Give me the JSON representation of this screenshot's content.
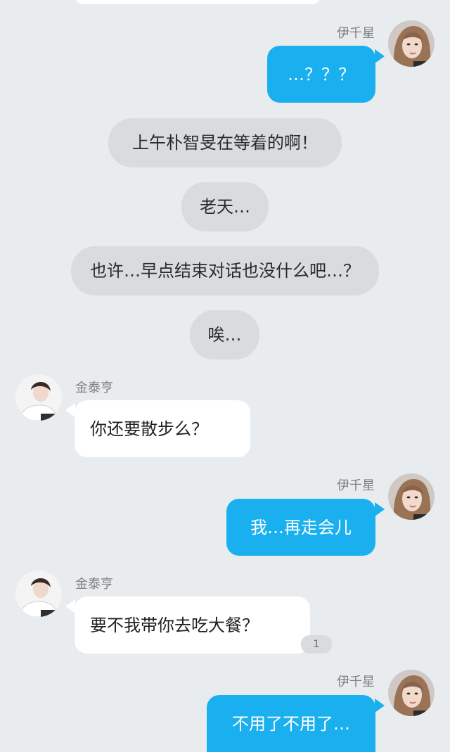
{
  "participants": {
    "me": {
      "name": "伊千星"
    },
    "other": {
      "name": "金泰亨"
    }
  },
  "messages": [
    {
      "id": "m1",
      "type": "outgoing",
      "text": "…？？？"
    },
    {
      "id": "m2",
      "type": "narration",
      "text": "上午朴智旻在等着的啊！"
    },
    {
      "id": "m3",
      "type": "narration",
      "text": "老天…"
    },
    {
      "id": "m4",
      "type": "narration",
      "text": "也许…早点结束对话也没什么吧…？"
    },
    {
      "id": "m5",
      "type": "narration",
      "text": "唉…"
    },
    {
      "id": "m6",
      "type": "incoming",
      "text": "你还要散步么？"
    },
    {
      "id": "m7",
      "type": "outgoing",
      "text": "我…再走会儿"
    },
    {
      "id": "m8",
      "type": "incoming",
      "text": "要不我带你去吃大餐？",
      "unread_count": "1"
    },
    {
      "id": "m9",
      "type": "outgoing",
      "text": "不用了不用了…"
    }
  ],
  "colors": {
    "background": "#e8ecee",
    "outgoing_bubble": "#1ab0ef",
    "incoming_bubble": "#ffffff",
    "narration_bubble": "#d8dcdf"
  },
  "icons": {
    "my_avatar": "avatar-woman-icon",
    "other_avatar": "avatar-man-icon"
  }
}
